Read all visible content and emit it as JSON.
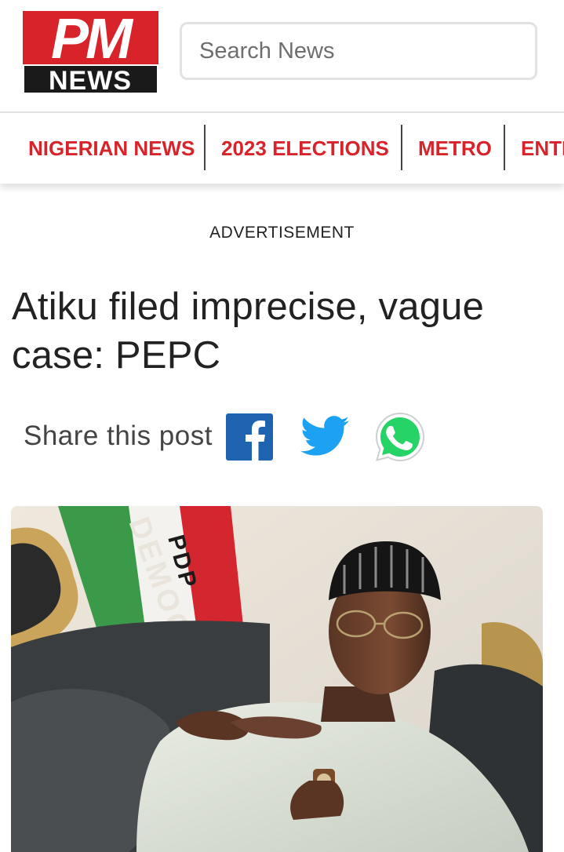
{
  "logo": {
    "top_text": "PM",
    "bottom_text": "NEWS"
  },
  "search": {
    "placeholder": "Search News"
  },
  "nav": {
    "items": [
      "NIGERIAN NEWS",
      "2023 ELECTIONS",
      "METRO",
      "ENTE"
    ]
  },
  "advertisement_label": "ADVERTISEMENT",
  "article": {
    "title": "Atiku filed imprecise, vague case: PEPC"
  },
  "share": {
    "label": "Share this post",
    "icons": [
      "facebook-icon",
      "twitter-icon",
      "whatsapp-icon"
    ]
  },
  "photo": {
    "flag_text": "DEMOC",
    "flag_sub_text": "PDP"
  },
  "colors": {
    "brand_red": "#d8232a",
    "facebook": "#1e63b0",
    "twitter": "#1da1f2",
    "whatsapp": "#25d366"
  }
}
